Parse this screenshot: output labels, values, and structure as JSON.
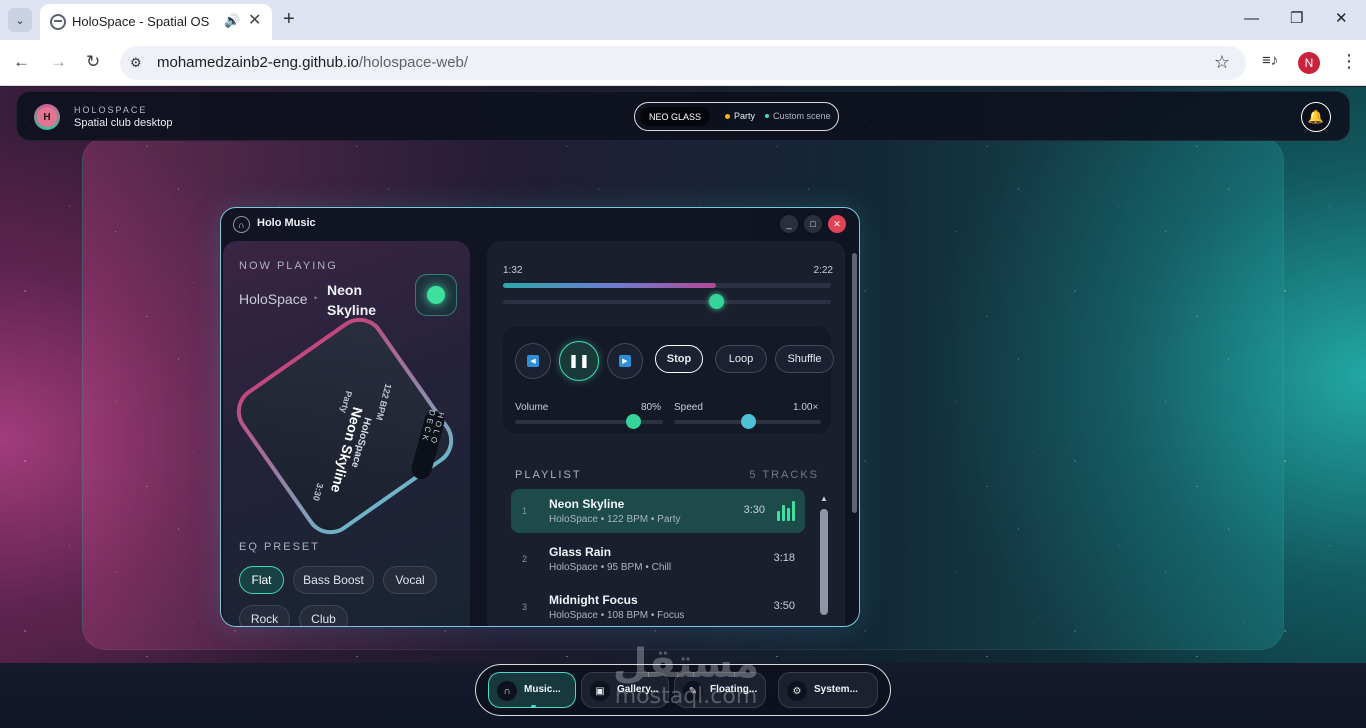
{
  "browser": {
    "tab_title": "HoloSpace - Spatial OS",
    "url_domain": "mohamedzainb2-eng.github.io",
    "url_path": "/holospace-web/",
    "profile_initial": "N"
  },
  "topbar": {
    "logo_letter": "H",
    "brand": "HOLOSPACE",
    "subtitle": "Spatial club desktop",
    "theme": "NEO GLASS",
    "scene_party": "Party",
    "scene_custom": "Custom scene"
  },
  "window": {
    "title": "Holo Music"
  },
  "now_playing": {
    "label": "NOW PLAYING",
    "artist": "HoloSpace",
    "title": "Neon Skyline",
    "deck_badge": "HOLO DECK",
    "deck_bpm": "122 BPM",
    "deck_genre": "Party",
    "deck_duration": "3:30"
  },
  "eq": {
    "label": "EQ PRESET",
    "presets": [
      "Flat",
      "Bass Boost",
      "Vocal",
      "Rock",
      "Club"
    ],
    "active": "Flat"
  },
  "player": {
    "time_current": "1:32",
    "time_total": "2:22",
    "progress": 0.65,
    "stop": "Stop",
    "loop": "Loop",
    "shuffle": "Shuffle",
    "volume_label": "Volume",
    "volume_value": "80%",
    "volume_level": 0.8,
    "speed_label": "Speed",
    "speed_value": "1.00×",
    "speed_level": 0.5
  },
  "playlist": {
    "label": "PLAYLIST",
    "count": "5 TRACKS",
    "tracks": [
      {
        "num": "1",
        "title": "Neon Skyline",
        "meta": "HoloSpace • 122 BPM • Party",
        "duration": "3:30"
      },
      {
        "num": "2",
        "title": "Glass Rain",
        "meta": "HoloSpace • 95 BPM • Chill",
        "duration": "3:18"
      },
      {
        "num": "3",
        "title": "Midnight Focus",
        "meta": "HoloSpace • 108 BPM • Focus",
        "duration": "3:50"
      }
    ]
  },
  "dock": {
    "items": [
      {
        "label": "Music...",
        "icon": "headphones-icon"
      },
      {
        "label": "Gallery...",
        "icon": "gallery-icon"
      },
      {
        "label": "Floating...",
        "icon": "note-icon"
      },
      {
        "label": "System...",
        "icon": "gear-icon"
      }
    ]
  },
  "watermark": {
    "arabic": "مستقل",
    "latin": "mostaql.com"
  },
  "colors": {
    "accent": "#3ee0a0",
    "border": "#7cc7d9",
    "close": "#e04456",
    "party_dot": "#f4b418",
    "custom_dot": "#3ed9b1"
  }
}
